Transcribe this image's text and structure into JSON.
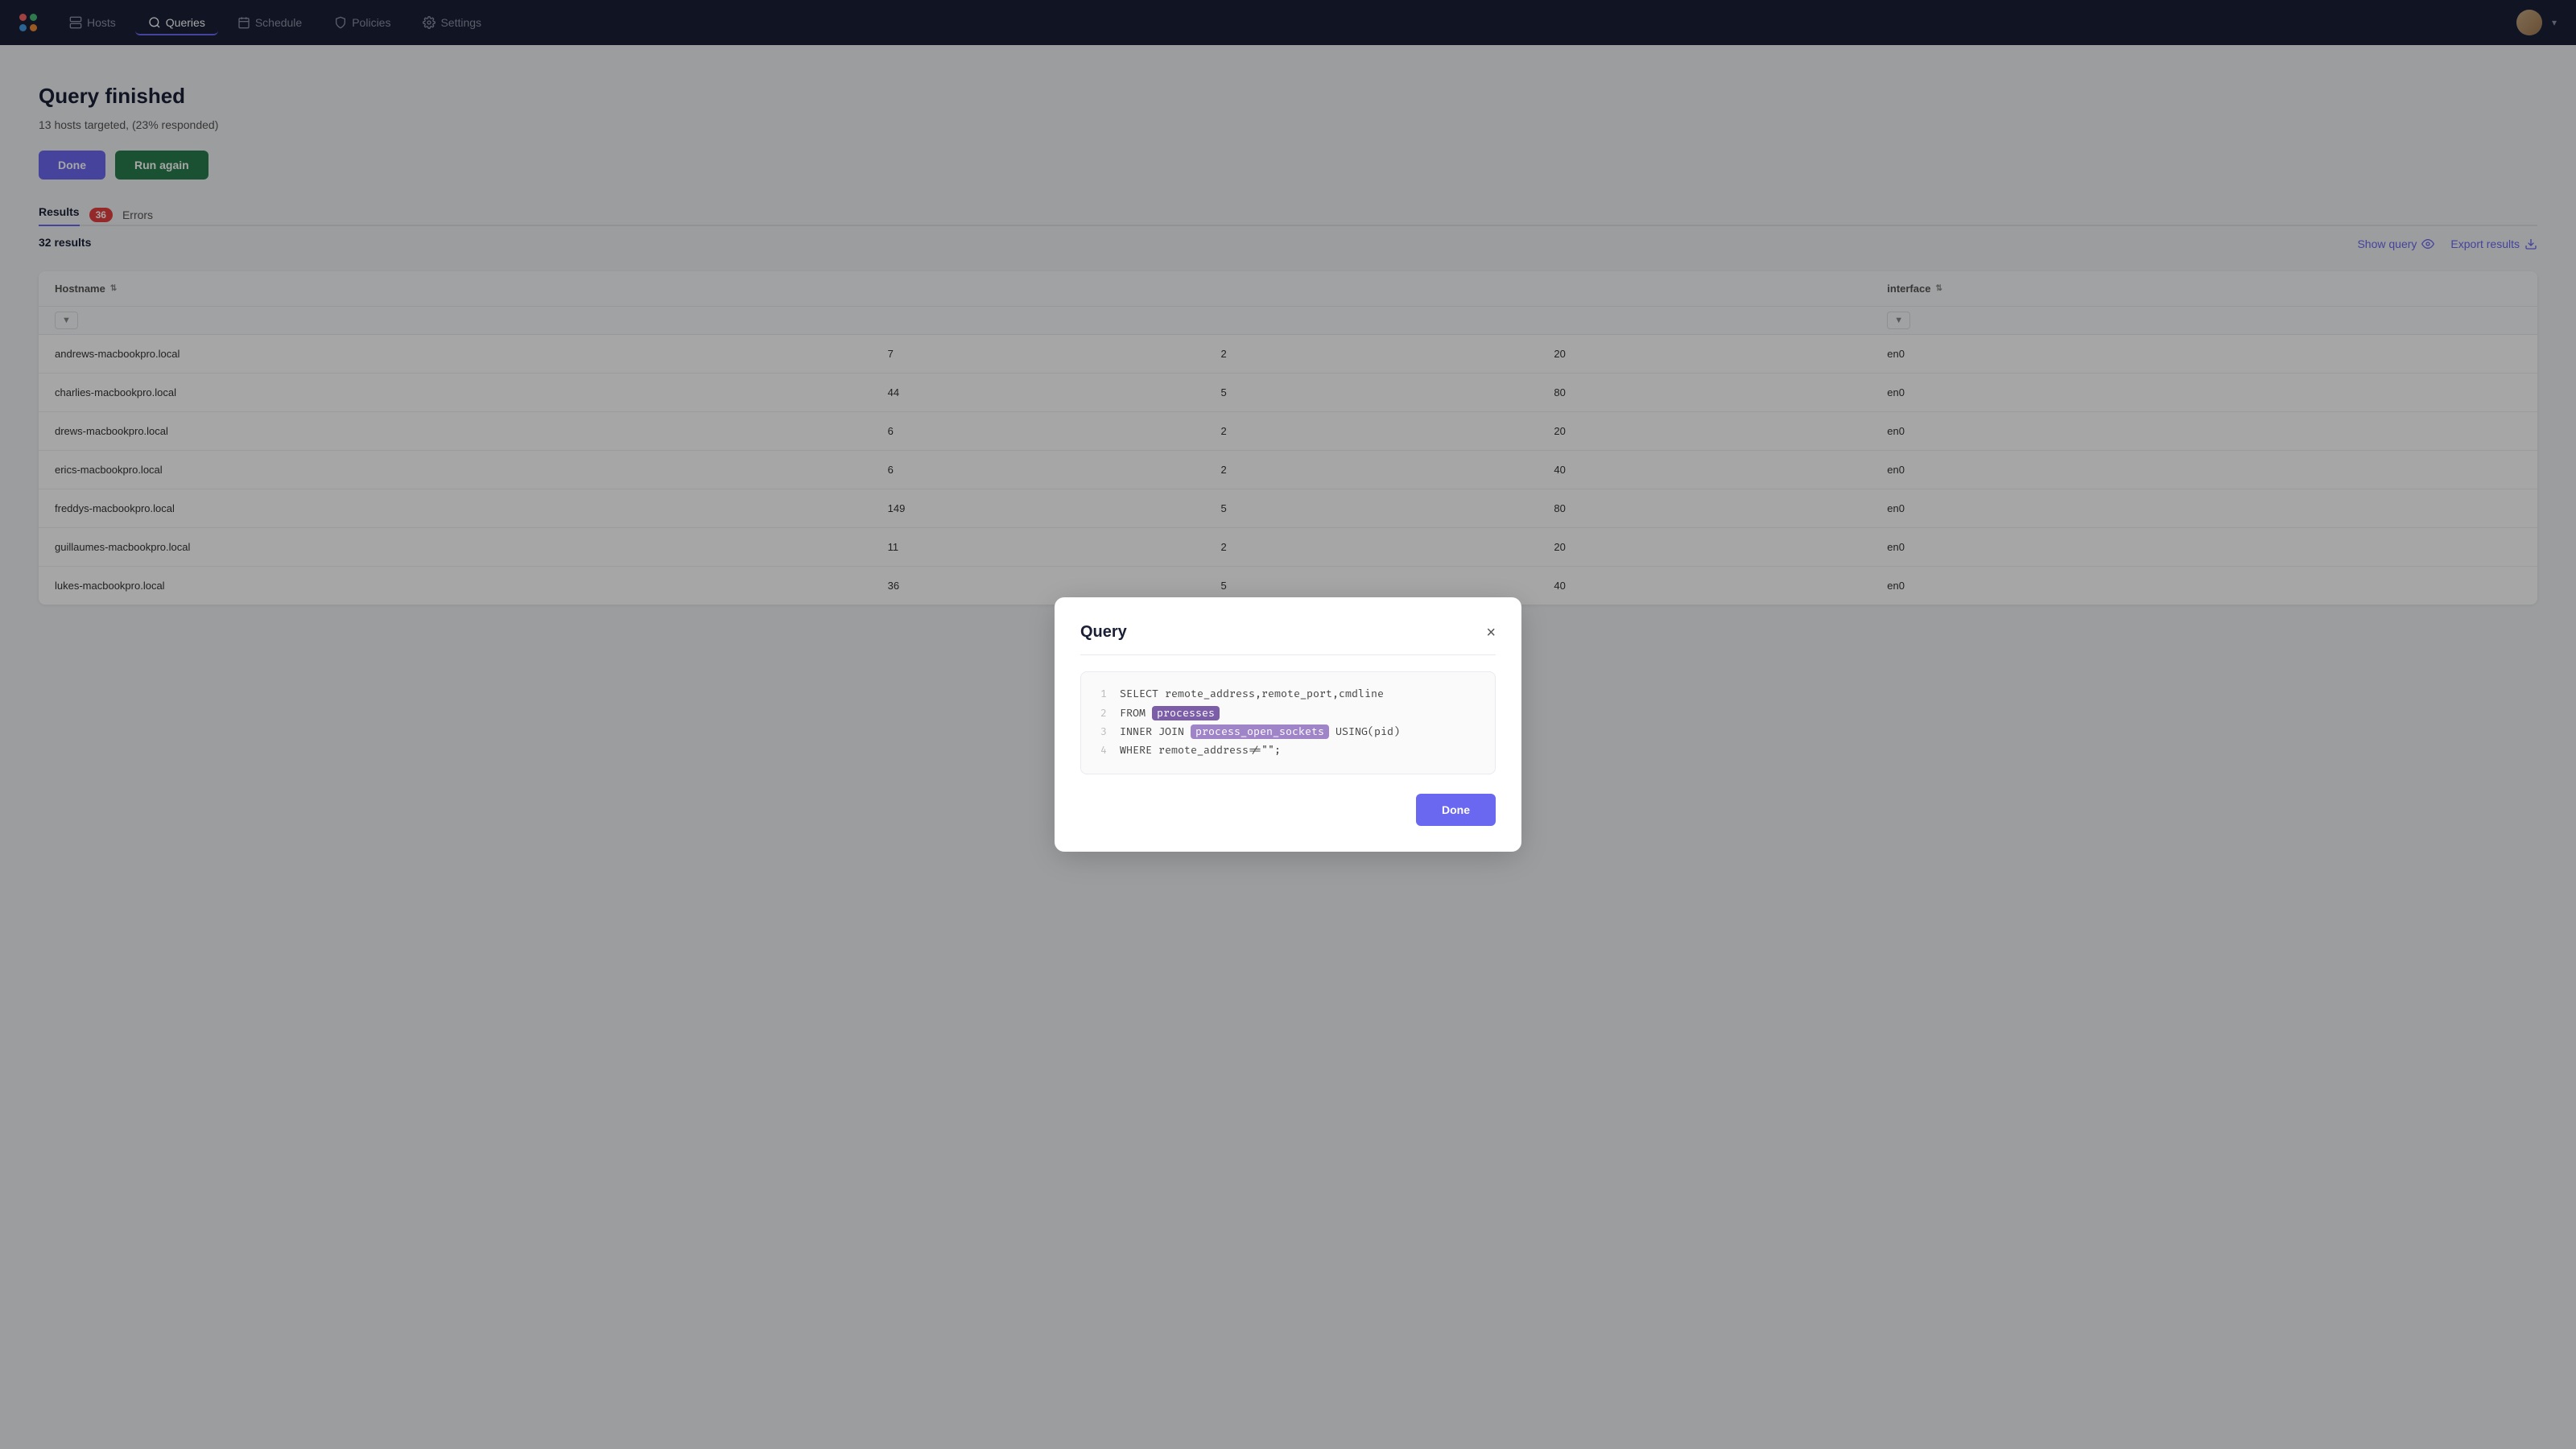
{
  "nav": {
    "logo_colors": [
      "#f56565",
      "#48bb78",
      "#4299e1",
      "#ed8936"
    ],
    "items": [
      {
        "label": "Hosts",
        "icon": "server-icon",
        "active": false
      },
      {
        "label": "Queries",
        "icon": "query-icon",
        "active": true
      },
      {
        "label": "Schedule",
        "icon": "schedule-icon",
        "active": false
      },
      {
        "label": "Policies",
        "icon": "policies-icon",
        "active": false
      },
      {
        "label": "Settings",
        "icon": "settings-icon",
        "active": false
      }
    ]
  },
  "page": {
    "title": "Query finished",
    "subtitle": "13 hosts targeted, (23% responded)",
    "subtitle_count": "13",
    "subtitle_percent": "23%"
  },
  "buttons": {
    "done": "Done",
    "run_again": "Run again"
  },
  "results_section": {
    "tab_label": "Results",
    "errors_count": "36",
    "errors_label": "Errors",
    "results_count": "32 results",
    "show_query": "Show query",
    "export_results": "Export results"
  },
  "table": {
    "columns": [
      "Hostname",
      "",
      "",
      "",
      "interface"
    ],
    "rows": [
      {
        "hostname": "andrews-macbookpro.local",
        "col2": "7",
        "col3": "2",
        "col4": "20",
        "interface": "en0"
      },
      {
        "hostname": "charlies-macbookpro.local",
        "col2": "44",
        "col3": "5",
        "col4": "80",
        "interface": "en0"
      },
      {
        "hostname": "drews-macbookpro.local",
        "col2": "6",
        "col3": "2",
        "col4": "20",
        "interface": "en0"
      },
      {
        "hostname": "erics-macbookpro.local",
        "col2": "6",
        "col3": "2",
        "col4": "40",
        "interface": "en0"
      },
      {
        "hostname": "freddys-macbookpro.local",
        "col2": "149",
        "col3": "5",
        "col4": "80",
        "interface": "en0"
      },
      {
        "hostname": "guillaumes-macbookpro.local",
        "col2": "11",
        "col3": "2",
        "col4": "20",
        "interface": "en0"
      },
      {
        "hostname": "lukes-macbookpro.local",
        "col2": "36",
        "col3": "5",
        "col4": "40",
        "interface": "en0"
      }
    ]
  },
  "modal": {
    "title": "Query",
    "close_label": "×",
    "code_lines": [
      {
        "num": "1",
        "text": "SELECT remote_address,remote_port,cmdline"
      },
      {
        "num": "2",
        "text_parts": [
          {
            "text": "FROM ",
            "highlight": null
          },
          {
            "text": "processes",
            "highlight": "purple"
          }
        ]
      },
      {
        "num": "3",
        "text_parts": [
          {
            "text": "INNER JOIN ",
            "highlight": null
          },
          {
            "text": "process_open_sockets",
            "highlight": "lavender"
          },
          {
            "text": " USING(pid)",
            "highlight": null
          }
        ]
      },
      {
        "num": "4",
        "text": "WHERE remote_address!=\"\";"
      }
    ],
    "done_button": "Done"
  }
}
